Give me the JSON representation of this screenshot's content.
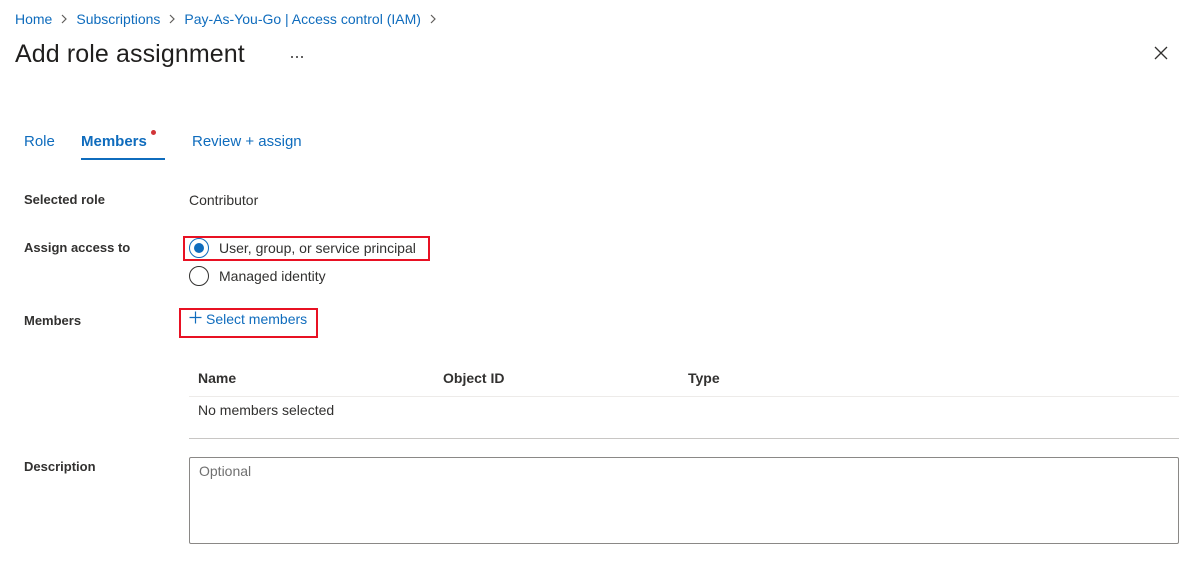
{
  "breadcrumb": {
    "items": [
      "Home",
      "Subscriptions",
      "Pay-As-You-Go | Access control (IAM)"
    ]
  },
  "header": {
    "title": "Add role assignment",
    "more_label": "···"
  },
  "tabs": [
    {
      "label": "Role"
    },
    {
      "label": "Members",
      "active": true
    },
    {
      "label": "Review + assign"
    }
  ],
  "form": {
    "selected_role_label": "Selected role",
    "selected_role_value": "Contributor",
    "assign_access_label": "Assign access to",
    "assign_options": [
      {
        "label": "User, group, or service principal",
        "checked": true
      },
      {
        "label": "Managed identity",
        "checked": false
      }
    ],
    "members_label": "Members",
    "select_members_label": "Select members",
    "description_label": "Description",
    "description_placeholder": "Optional"
  },
  "table": {
    "columns": [
      "Name",
      "Object ID",
      "Type"
    ],
    "empty_text": "No members selected"
  },
  "colors": {
    "accent": "#0f6cbd",
    "highlight": "#e81123",
    "indicator_dot": "#d13438"
  }
}
